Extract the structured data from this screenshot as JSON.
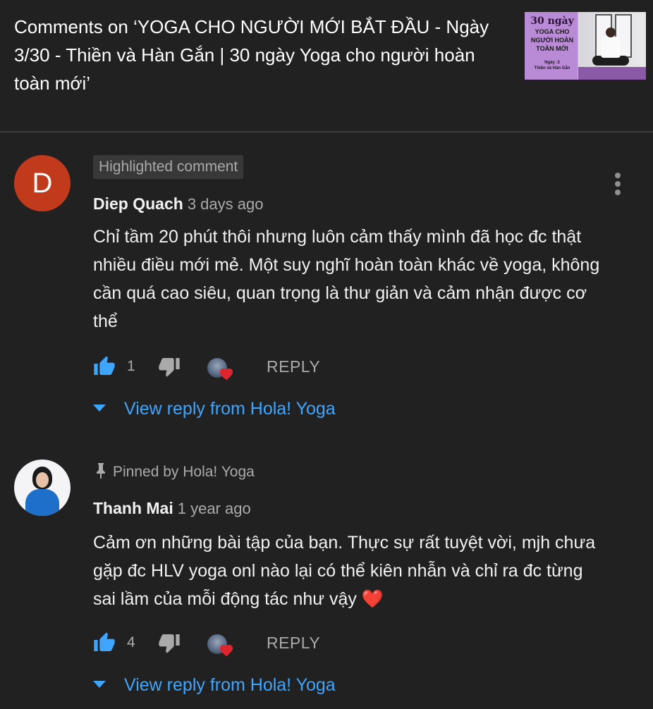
{
  "header": {
    "title": "Comments on ‘YOGA CHO NGƯỜI MỚI BẮT ĐẦU - Ngày 3/30 - Thiền và Hàn Gắn | 30 ngày Yoga cho người hoàn toàn mới’",
    "thumbnail": {
      "line1": "30 ngày",
      "line2": "YOGA CHO",
      "line3": "NGƯỜI HOÀN",
      "line4": "TOÀN MỚI",
      "line5": "Ngày :3",
      "line6": "Thiền và Hàn Gắn"
    }
  },
  "comments": [
    {
      "avatar_letter": "D",
      "badge": "Highlighted comment",
      "author": "Diep Quach",
      "time": "3 days ago",
      "text": "Chỉ tầm 20 phút thôi nhưng luôn cảm thấy mình đã học đc thật nhiều điều mới mẻ. Một suy nghĩ hoàn toàn khác về yoga, không cần quá cao siêu, quan trọng là thư giản và cảm nhận được cơ thể",
      "likes": "1",
      "reply_label": "REPLY",
      "view_reply": "View reply from Hola! Yoga"
    },
    {
      "pinned": "Pinned by Hola! Yoga",
      "author": "Thanh Mai",
      "time": "1 year ago",
      "text": "Cảm ơn những bài tập của bạn. Thực sự rất tuyệt vời, mjh chưa gặp đc HLV yoga onl nào lại có thể kiên nhẫn và chỉ ra đc từng sai lầm của mỗi động tác như vậy",
      "emoji": "❤️",
      "likes": "4",
      "reply_label": "REPLY",
      "view_reply": "View reply from Hola! Yoga"
    }
  ],
  "colors": {
    "background": "#212121",
    "link": "#3ea6ff",
    "like_active": "#3ea6ff",
    "heart": "#e0242e",
    "avatar_d": "#c23a1c"
  }
}
